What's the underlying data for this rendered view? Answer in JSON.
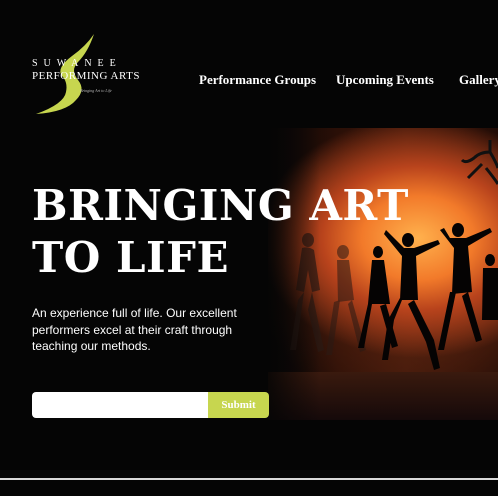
{
  "logo": {
    "line1": "SUWANEE",
    "line2": "PERFORMING ARTS",
    "tagline": "Bringing Art to Life",
    "accent_color": "#c7d64f"
  },
  "nav": {
    "items": [
      {
        "label": "Performance Groups"
      },
      {
        "label": "Upcoming Events"
      },
      {
        "label": "Gallery"
      }
    ]
  },
  "hero": {
    "headline_line1": "BRINGING ART",
    "headline_line2": "TO LIFE",
    "description": "An experience full of life. Our excellent performers excel at their craft through teaching our methods."
  },
  "signup": {
    "input_value": "",
    "input_placeholder": "",
    "submit_label": "Submit",
    "button_color": "#c7d64f"
  }
}
